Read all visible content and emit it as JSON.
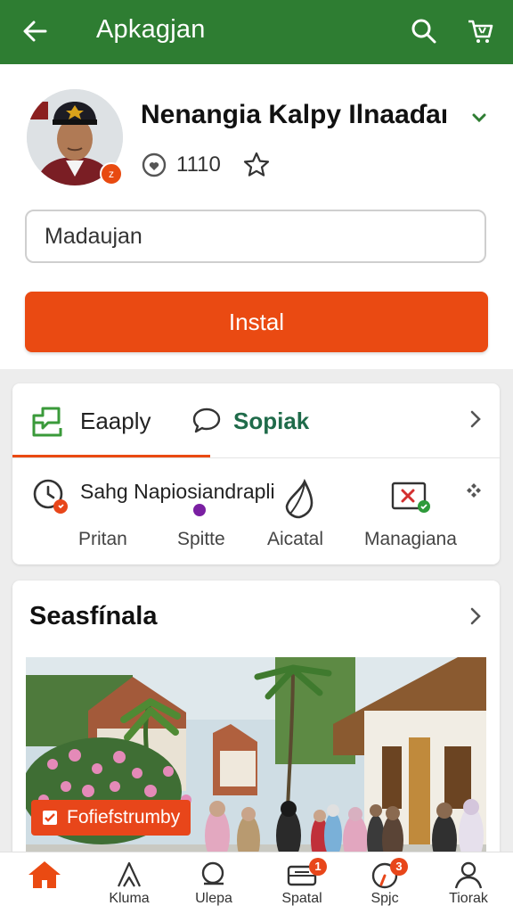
{
  "topbar": {
    "title": "Apkagjan",
    "back_icon": "arrow-left-icon",
    "search_icon": "search-icon",
    "cart_icon": "cart-icon"
  },
  "profile": {
    "name": "Nenangia Kalpy Ilnaaɗaı",
    "avatar_badge": "z",
    "rating_count": "1110",
    "input_value": "Madaujan",
    "install_label": "Instal"
  },
  "tabs": {
    "items": [
      {
        "label": "Eaaply",
        "icon": "chat-bubble-icon"
      },
      {
        "label": "Sopiak",
        "icon": "speech-bubble-icon"
      }
    ],
    "top_label": "Sahg Napiosiandrapli",
    "sub_items": [
      {
        "label": "Pritan",
        "icon": "clock-icon"
      },
      {
        "label": "Spitte",
        "icon": "dot-icon"
      },
      {
        "label": "Aicatal",
        "icon": "leaf-icon"
      },
      {
        "label": "Managiana",
        "icon": "box-x-icon"
      }
    ]
  },
  "season": {
    "title": "Seasfínala",
    "tag": "Fofiefstrumby"
  },
  "bottom_nav": [
    {
      "label": "",
      "icon": "home-icon"
    },
    {
      "label": "Kluma",
      "icon": "tent-icon"
    },
    {
      "label": "Ulepa",
      "icon": "search-icon"
    },
    {
      "label": "Spatal",
      "icon": "inbox-icon",
      "badge": "1"
    },
    {
      "label": "Spjc",
      "icon": "gauge-icon",
      "badge": "3"
    },
    {
      "label": "Tiorak",
      "icon": "user-icon"
    }
  ],
  "colors": {
    "green": "#2e7d32",
    "accent": "#ea4a12",
    "tab_active_text": "#1f6b4a"
  }
}
